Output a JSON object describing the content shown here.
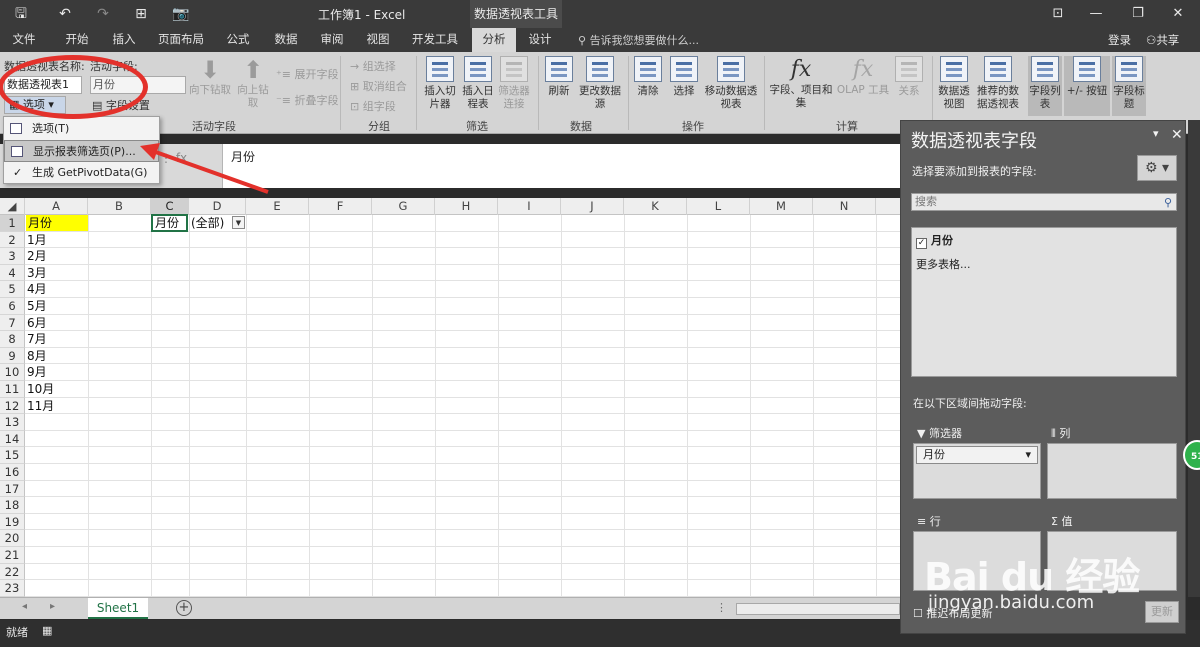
{
  "window": {
    "title": "工作簿1 - Excel",
    "context_tool": "数据透视表工具",
    "controls": {
      "minimize": "—",
      "restore": "❐",
      "close": "✕",
      "ribbon_display": "⊡"
    }
  },
  "quick_access": {
    "save": "🖫",
    "undo": "↶",
    "redo": "↷",
    "print_preview": "⊞",
    "camera": "📷"
  },
  "tabs": [
    {
      "label": "文件",
      "active": false
    },
    {
      "label": "开始",
      "active": false
    },
    {
      "label": "插入",
      "active": false
    },
    {
      "label": "页面布局",
      "active": false
    },
    {
      "label": "公式",
      "active": false
    },
    {
      "label": "数据",
      "active": false
    },
    {
      "label": "审阅",
      "active": false
    },
    {
      "label": "视图",
      "active": false
    },
    {
      "label": "开发工具",
      "active": false
    },
    {
      "label": "分析",
      "active": true
    },
    {
      "label": "设计",
      "active": false
    }
  ],
  "tell_me": "告诉我您想要做什么...",
  "account": {
    "login": "登录",
    "share": "共享"
  },
  "ribbon": {
    "pivot_name_label": "数据透视表名称:",
    "pivot_name_value": "数据透视表1",
    "options_label": "选项",
    "active_field_label": "活动字段:",
    "active_field_value": "月份",
    "field_settings": "字段设置",
    "drill_down": "向下钻取",
    "drill_up": "向上钻取",
    "expand_field": "展开字段",
    "collapse_field": "折叠字段",
    "group_selection": "组选择",
    "ungroup": "取消组合",
    "group_field": "组字段",
    "insert_slicer": "插入切片器",
    "insert_timeline": "插入日程表",
    "filter_connections": "筛选器连接",
    "refresh": "刷新",
    "change_source": "更改数据源",
    "clear": "清除",
    "select": "选择",
    "move_pivot": "移动数据透视表",
    "fields_items_sets": "字段、项目和集",
    "olap_tools": "OLAP 工具",
    "relationships": "关系",
    "pivot_chart": "数据透视图",
    "recommended_pivots": "推荐的数据透视表",
    "field_list": "字段列表",
    "plus_minus_buttons": "+/- 按钮",
    "field_headers": "字段标题",
    "groups": {
      "active_field": "活动字段",
      "group": "分组",
      "filter": "筛选",
      "data": "数据",
      "actions": "操作",
      "calculations": "计算"
    }
  },
  "dropdown_menu": {
    "items": [
      {
        "label": "选项(T)",
        "highlighted": false
      },
      {
        "label": "显示报表筛选页(P)...",
        "highlighted": true
      },
      {
        "label": "生成 GetPivotData(G)",
        "highlighted": false,
        "checked": true
      }
    ]
  },
  "formula_bar": {
    "fx": "fx",
    "value": "月份"
  },
  "grid": {
    "columns": [
      "A",
      "B",
      "C",
      "D",
      "E",
      "F",
      "G",
      "H",
      "I",
      "J",
      "K",
      "L",
      "M",
      "N"
    ],
    "rows": [
      "1",
      "2",
      "3",
      "4",
      "5",
      "6",
      "7",
      "8",
      "9",
      "10",
      "11",
      "12",
      "13",
      "14",
      "15",
      "16",
      "17",
      "18",
      "19",
      "20",
      "21",
      "22",
      "23"
    ],
    "column_a": [
      "月份",
      "1月",
      "2月",
      "3月",
      "4月",
      "5月",
      "6月",
      "7月",
      "8月",
      "9月",
      "10月",
      "11月"
    ],
    "c1": "月份",
    "d1": "(全部)",
    "selected_column": "C",
    "selected_row": "1",
    "highlight_color": "#ffff00"
  },
  "sheets": {
    "active": "Sheet1",
    "add": "+"
  },
  "status": {
    "ready": "就绪"
  },
  "pivot_pane": {
    "title": "数据透视表字段",
    "subtitle": "选择要添加到报表的字段:",
    "search_placeholder": "搜索",
    "fields": [
      {
        "label": "月份",
        "checked": true
      }
    ],
    "more_tables": "更多表格...",
    "drag_hint": "在以下区域间拖动字段:",
    "areas": {
      "filters": "筛选器",
      "columns": "列",
      "rows": "行",
      "values": "值"
    },
    "filter_chip": "月份",
    "defer_update": "推迟布局更新",
    "update_button": "更新"
  },
  "badge": "51",
  "watermark": {
    "logo": "Bai du 经验",
    "url": "jingyan.baidu.com"
  },
  "colors": {
    "accent_green": "#217346",
    "annotation_red": "#e3312b"
  }
}
